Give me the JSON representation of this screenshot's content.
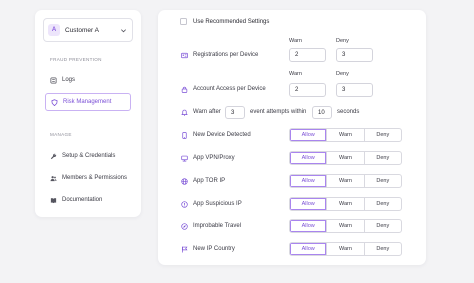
{
  "account": {
    "initial": "A",
    "name": "Customer A"
  },
  "sidebar": {
    "section_fraud": "FRAUD PREVENTION",
    "section_manage": "MANAGE",
    "items": [
      {
        "label": "Logs",
        "icon": "list-icon"
      },
      {
        "label": "Risk Management",
        "icon": "shield-icon",
        "active": true
      },
      {
        "label": "Setup & Credentials",
        "icon": "wrench-icon"
      },
      {
        "label": "Members & Permissions",
        "icon": "users-icon"
      },
      {
        "label": "Documentation",
        "icon": "book-icon"
      }
    ]
  },
  "settings": {
    "use_recommended": "Use Recommended Settings",
    "col_warn": "Warn",
    "col_deny": "Deny",
    "registrations": {
      "label": "Registrations per Device",
      "warn": "2",
      "deny": "3"
    },
    "account_access": {
      "label": "Account Access per Device",
      "warn": "2",
      "deny": "3"
    },
    "warn_after": {
      "prefix": "Warn after",
      "attempts": "3",
      "middle": "event attempts within",
      "seconds": "10",
      "suffix": "seconds"
    },
    "options": [
      "Allow",
      "Warn",
      "Deny"
    ],
    "rules": [
      {
        "label": "New Device Detected",
        "icon": "phone-icon",
        "selected": "Allow"
      },
      {
        "label": "App VPN/Proxy",
        "icon": "network-icon",
        "selected": "Allow"
      },
      {
        "label": "App TOR IP",
        "icon": "globe-icon",
        "selected": "Allow"
      },
      {
        "label": "App Suspicious IP",
        "icon": "alert-globe-icon",
        "selected": "Allow"
      },
      {
        "label": "Improbable Travel",
        "icon": "compass-icon",
        "selected": "Allow"
      },
      {
        "label": "New IP Country",
        "icon": "flag-icon",
        "selected": "Allow"
      }
    ]
  },
  "colors": {
    "accent": "#7a4fd6",
    "accent_border": "#c9b2f3",
    "background": "#f3f3f5"
  }
}
